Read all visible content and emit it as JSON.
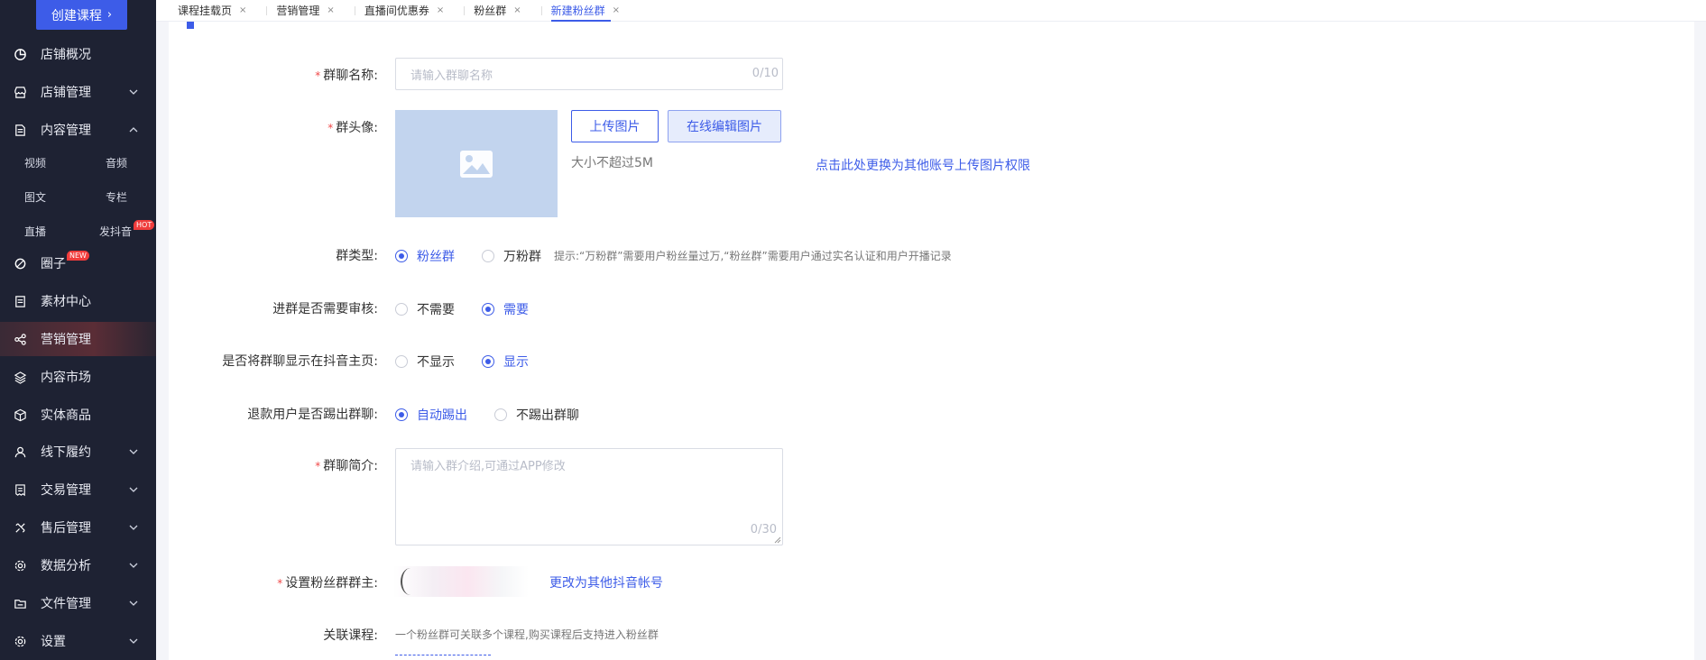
{
  "sidebar": {
    "create_label": "创建课程",
    "items": {
      "shop_overview": "店铺概况",
      "shop_manage": "店铺管理",
      "content_manage": "内容管理",
      "circle": "圈子",
      "material": "素材中心",
      "marketing": "营销管理",
      "content_market": "内容市场",
      "physical": "实体商品",
      "offline": "线下履约",
      "trade": "交易管理",
      "aftersale": "售后管理",
      "analytics": "数据分析",
      "files": "文件管理",
      "settings": "设置"
    },
    "sub": {
      "video": "视频",
      "audio": "音频",
      "article": "图文",
      "column": "专栏",
      "live": "直播",
      "douyin": "发抖音"
    },
    "badges": {
      "hot": "HOT",
      "new": "NEW"
    }
  },
  "tabs": [
    "课程挂载页",
    "营销管理",
    "直播间优惠券",
    "粉丝群",
    "新建粉丝群"
  ],
  "tab_close": "×",
  "form": {
    "group_name": {
      "label": "群聊名称:",
      "placeholder": "请输入群聊名称",
      "counter": "0/10"
    },
    "avatar": {
      "label": "群头像:",
      "upload": "上传图片",
      "edit_online": "在线编辑图片",
      "size_hint": "大小不超过5M",
      "switch_link": "点击此处更换为其他账号上传图片权限"
    },
    "group_type": {
      "label": "群类型:",
      "options": [
        "粉丝群",
        "万粉群"
      ],
      "selected": "粉丝群",
      "hint": "提示:“万粉群”需要用户粉丝量过万,“粉丝群”需要用户通过实名认证和用户开播记录"
    },
    "review": {
      "label": "进群是否需要审核:",
      "options": [
        "不需要",
        "需要"
      ],
      "selected": "需要"
    },
    "show_home": {
      "label": "是否将群聊显示在抖音主页:",
      "options": [
        "不显示",
        "显示"
      ],
      "selected": "显示"
    },
    "refund_kick": {
      "label": "退款用户是否踢出群聊:",
      "options": [
        "自动踢出",
        "不踢出群聊"
      ],
      "selected": "自动踢出"
    },
    "intro": {
      "label": "群聊简介:",
      "placeholder": "请输入群介绍,可通过APP修改",
      "counter": "0/30"
    },
    "owner": {
      "label": "设置粉丝群群主:",
      "change_link": "更改为其他抖音帐号"
    },
    "course": {
      "label": "关联课程:",
      "hint": "一个粉丝群可关联多个课程,购买课程后支持进入粉丝群"
    }
  },
  "colors": {
    "accent": "#3d5ce8",
    "sidebar_bg": "#1e2233",
    "required": "#f04848"
  }
}
